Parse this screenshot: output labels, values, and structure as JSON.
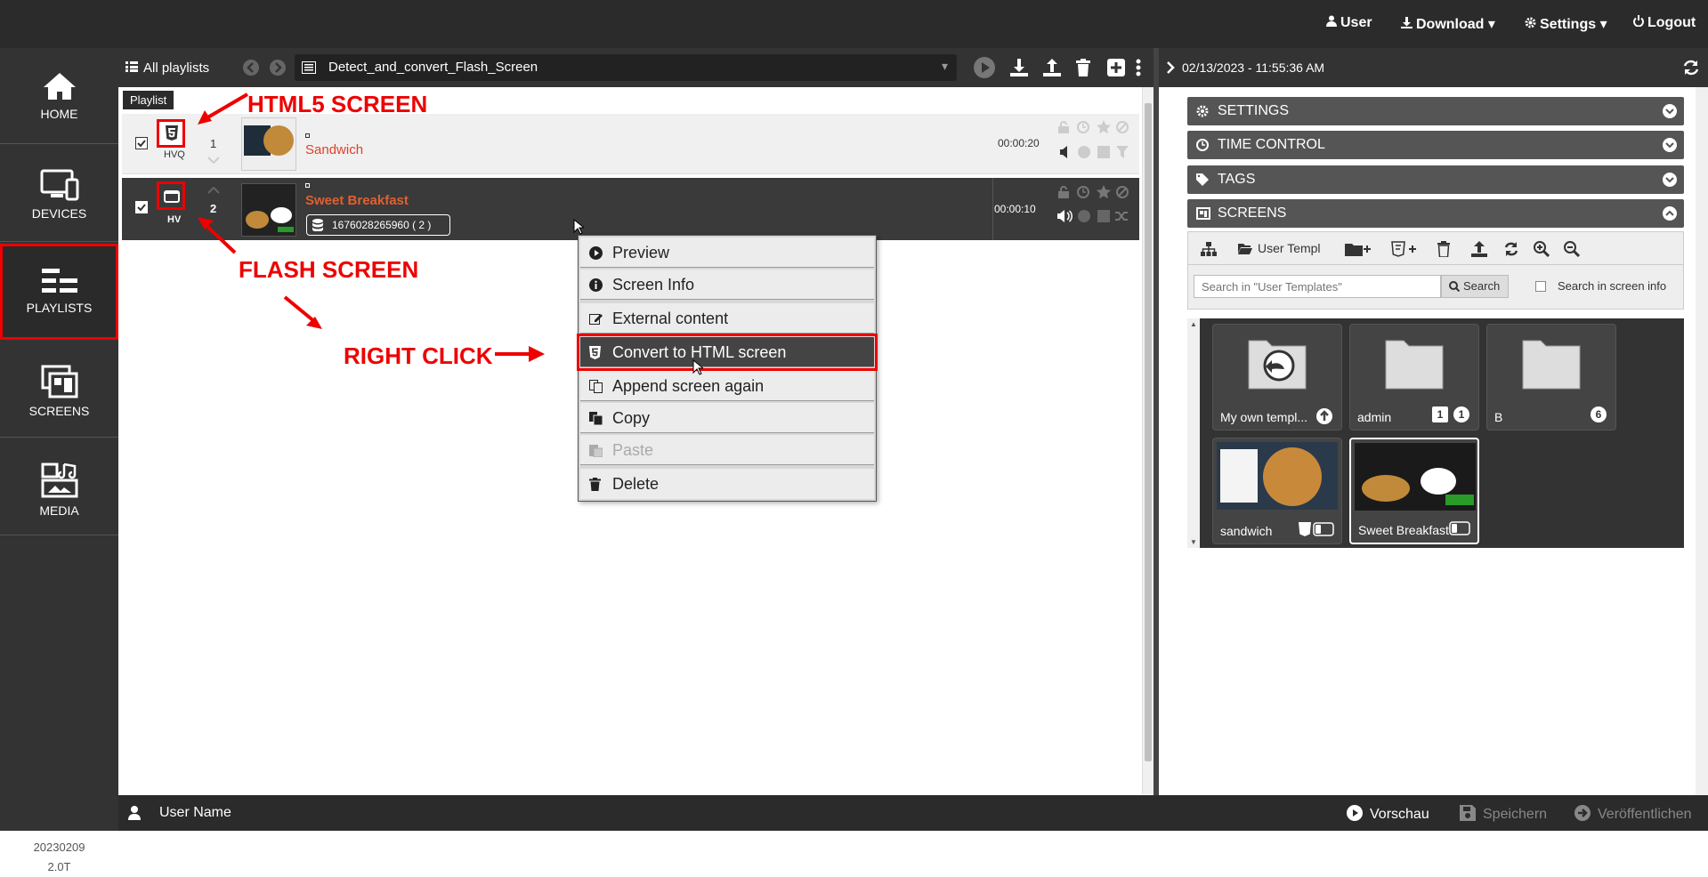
{
  "topbar": {
    "user_label": "User",
    "download_label": "Download",
    "settings_label": "Settings",
    "logout_label": "Logout"
  },
  "sidebar": {
    "items": [
      {
        "label": "HOME",
        "icon": "home-icon"
      },
      {
        "label": "DEVICES",
        "icon": "devices-icon"
      },
      {
        "label": "PLAYLISTS",
        "icon": "playlists-icon"
      },
      {
        "label": "SCREENS",
        "icon": "screens-icon"
      },
      {
        "label": "MEDIA",
        "icon": "media-icon"
      }
    ],
    "version_line1": "20230209",
    "version_line2": "2.0T"
  },
  "playlist_toolbar": {
    "all_playlists": "All playlists",
    "playlist_name": "Detect_and_convert_Flash_Screen",
    "tooltip": "Playlist"
  },
  "playlist_rows": [
    {
      "index": "1",
      "type_label": "HVQ",
      "title": "Sandwich",
      "duration": "00:00:20"
    },
    {
      "index": "2",
      "type_label": "HV",
      "title": "Sweet Breakfast",
      "duration": "00:00:10",
      "data_tag": "1676028265960 ( 2 )"
    }
  ],
  "annotations": {
    "html5": "HTML5 SCREEN",
    "flash": "FLASH SCREEN",
    "rightclick": "RIGHT CLICK"
  },
  "context_menu": {
    "items": [
      {
        "label": "Preview",
        "icon": "play-icon",
        "disabled": false
      },
      {
        "label": "Screen Info",
        "icon": "info-icon",
        "disabled": false
      },
      {
        "label": "External content",
        "icon": "edit-icon",
        "disabled": false
      },
      {
        "label": "Convert to HTML screen",
        "icon": "html5-icon",
        "disabled": false
      },
      {
        "label": "Append screen again",
        "icon": "append-icon",
        "disabled": false
      },
      {
        "label": "Copy",
        "icon": "copy-icon",
        "disabled": false
      },
      {
        "label": "Paste",
        "icon": "paste-icon",
        "disabled": true
      },
      {
        "label": "Delete",
        "icon": "trash-icon",
        "disabled": false
      }
    ]
  },
  "right_panel": {
    "datetime": "02/13/2023 - 11:55:36 AM",
    "sections": [
      "SETTINGS",
      "TIME CONTROL",
      "TAGS",
      "SCREENS"
    ],
    "folder_label": "User Templ",
    "search_placeholder": "Search in \"User Templates\"",
    "search_button": "Search",
    "search_in_info": "Search in screen info",
    "tiles": [
      {
        "label": "My own templ...",
        "badge": ""
      },
      {
        "label": "admin",
        "badge": "1",
        "badge2": "1"
      },
      {
        "label": "B",
        "badge": "6"
      },
      {
        "label": "sandwich",
        "badge": ""
      },
      {
        "label": "Sweet Breakfast",
        "badge": ""
      }
    ]
  },
  "bottombar": {
    "user_name": "User Name",
    "preview": "Vorschau",
    "save": "Speichern",
    "publish": "Veröffentlichen"
  },
  "colors": {
    "dark": "#2b2b2b",
    "accent_red": "#e00000",
    "title_red": "#e0402a",
    "selected_row": "#3a3a3a"
  }
}
